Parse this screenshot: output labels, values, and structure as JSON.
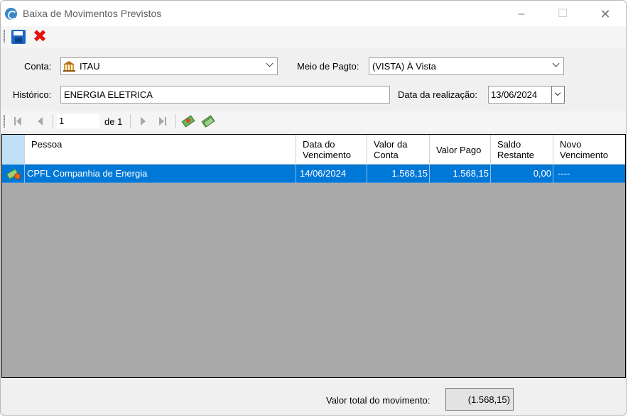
{
  "window": {
    "title": "Baixa de Movimentos Previstos",
    "minimize": "–",
    "maximize": "☐",
    "close": "✕"
  },
  "toolbar": {
    "save_icon": "save-icon",
    "cancel_icon": "cancel-icon",
    "cancel_glyph": "✖"
  },
  "form": {
    "conta_label": "Conta:",
    "conta_value": "ITAU",
    "meio_label": "Meio de Pagto:",
    "meio_value": "(VISTA) À Vista",
    "historico_label": "Histórico:",
    "historico_value": "ENERGIA ELETRICA",
    "data_label": "Data da realização:",
    "data_value": "13/06/2024"
  },
  "navigator": {
    "position": "1",
    "count_label": "de 1"
  },
  "grid": {
    "columns": [
      "Pessoa",
      "Data do\nVencimento",
      "Valor da\nConta",
      "Valor Pago",
      "Saldo\nRestante",
      "Novo\nVencimento"
    ],
    "rows": [
      {
        "pessoa": "CPFL Companhia de Energia",
        "data_vencimento": "14/06/2024",
        "valor_conta": "1.568,15",
        "valor_pago": "1.568,15",
        "saldo_restante": "0,00",
        "novo_vencimento": "----",
        "selected": true
      }
    ]
  },
  "footer": {
    "total_label": "Valor total do movimento:",
    "total_value": "(1.568,15)"
  },
  "colors": {
    "selection": "#0078d7",
    "grid_background": "#a9a9a9",
    "cancel_red": "#e3120b",
    "save_blue": "#1a66c6"
  }
}
